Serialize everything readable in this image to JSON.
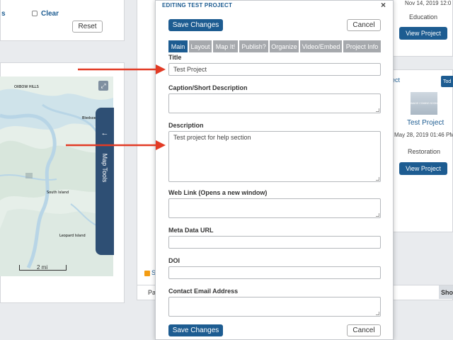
{
  "filter": {
    "left_text": "s",
    "clear_label": "Clear",
    "reset_label": "Reset"
  },
  "map": {
    "expand_icon": "⤢",
    "tools_arrow": "←",
    "tools_label": "Map Tools",
    "scale_label": "2 mi",
    "place_labels": [
      "OXBOW HILLS",
      "Bledsoe Island",
      "South Island",
      "Leopard Island"
    ]
  },
  "right_cards": {
    "card1": {
      "date": "Nov 14, 2019 12:0",
      "category": "Education",
      "view_label": "View Project"
    },
    "card2": {
      "link_fragment": "ect",
      "tod_label": "Tod",
      "thumb_text": "IMAGE COMING SOON",
      "title": "Test Project",
      "date": "May 28, 2019 01:46 PM",
      "category": "Restoration",
      "view_label": "View Project"
    }
  },
  "background": {
    "rss_text": "S",
    "row_text": "Pa",
    "show_label": "Show"
  },
  "modal": {
    "title": "EDITING TEST PROJECT",
    "close_icon": "×",
    "save_label": "Save Changes",
    "cancel_label": "Cancel",
    "tabs": [
      {
        "label": "Main",
        "active": true
      },
      {
        "label": "Layout",
        "active": false
      },
      {
        "label": "Map It!",
        "active": false
      },
      {
        "label": "Publish?",
        "active": false
      },
      {
        "label": "Organize",
        "active": false
      },
      {
        "label": "Video/Embed",
        "active": false
      },
      {
        "label": "Project Info",
        "active": false
      }
    ],
    "fields": {
      "title": {
        "label": "Title",
        "value": "Test Project"
      },
      "caption": {
        "label": "Caption/Short Description",
        "value": ""
      },
      "description": {
        "label": "Description",
        "value": "Test project for help section"
      },
      "weblink": {
        "label": "Web Link (Opens a new window)",
        "value": ""
      },
      "metadata": {
        "label": "Meta Data URL",
        "value": ""
      },
      "doi": {
        "label": "DOI",
        "value": ""
      },
      "email": {
        "label": "Contact Email Address",
        "value": ""
      }
    }
  },
  "colors": {
    "primary": "#1d5c91",
    "tab_inactive": "#a6a9ad",
    "arrow": "#e23b25",
    "map_tools": "#2e4f74"
  }
}
